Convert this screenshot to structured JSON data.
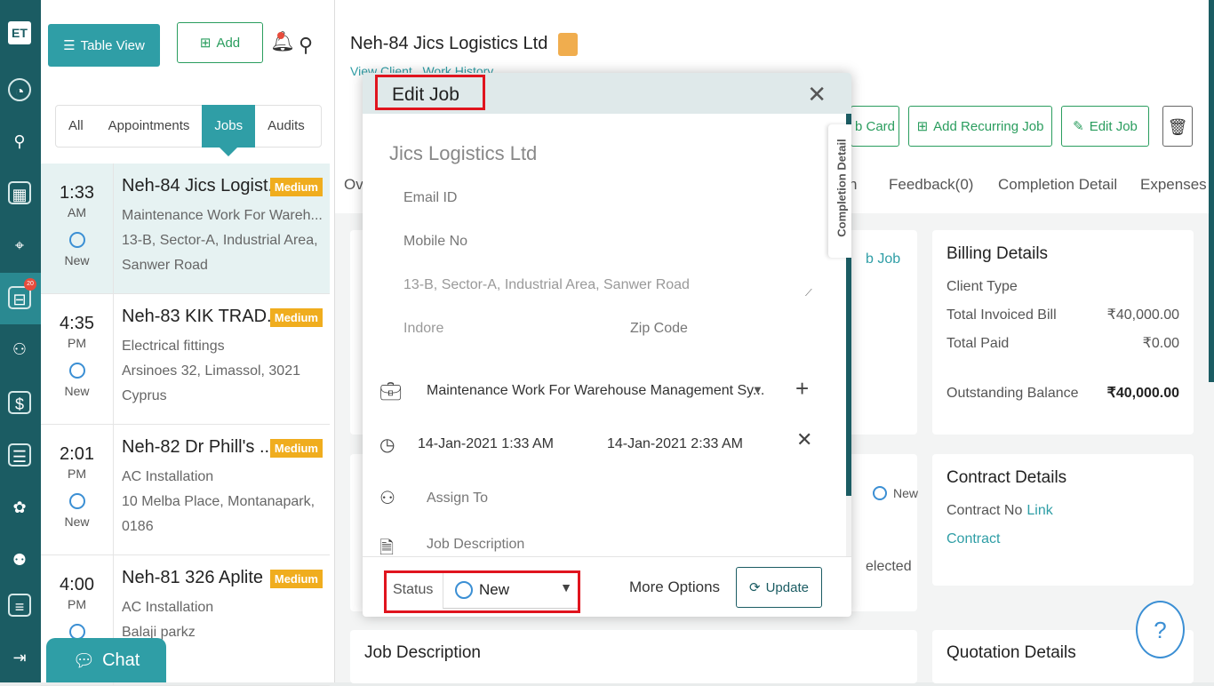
{
  "rail": {
    "logo": "ET",
    "badge": "20"
  },
  "toolbar": {
    "table_view": "Table View",
    "add": "Add"
  },
  "tabs": [
    {
      "label": "All"
    },
    {
      "label": "Appointments"
    },
    {
      "label": "Jobs"
    },
    {
      "label": "Audits"
    }
  ],
  "jobs": [
    {
      "time": "1:33",
      "ampm": "AM",
      "status": "New",
      "title": "Neh-84 Jics Logist...",
      "priority": "Medium",
      "line1": "Maintenance Work For Wareh...",
      "line2": "13-B, Sector-A, Industrial Area,",
      "line3": "Sanwer Road"
    },
    {
      "time": "4:35",
      "ampm": "PM",
      "status": "New",
      "title": "Neh-83 KIK TRAD...",
      "priority": "Medium",
      "line1": "Electrical fittings",
      "line2": "Arsinoes 32, Limassol, 3021",
      "line3": "Cyprus"
    },
    {
      "time": "2:01",
      "ampm": "PM",
      "status": "New",
      "title": "Neh-82 Dr Phill's ...",
      "priority": "Medium",
      "line1": "AC Installation",
      "line2": "10 Melba Place, Montanapark,",
      "line3": "0186"
    },
    {
      "time": "4:00",
      "ampm": "PM",
      "status": "",
      "title": "Neh-81 326 Aplite",
      "priority": "Medium",
      "line1": "AC Installation",
      "line2": "Balaji parkz",
      "line3": ""
    }
  ],
  "header": {
    "title": "Neh-84 Jics Logistics Ltd",
    "view_client": "View Client",
    "work_history": "Work History",
    "job_card_partial": "b Card",
    "add_recurring": "Add Recurring Job",
    "edit_job": "Edit Job"
  },
  "subtabs": {
    "ov": "Ov",
    "n": "n",
    "feedback": "Feedback(0)",
    "completion": "Completion Detail",
    "expenses": "Expenses"
  },
  "billing": {
    "title": "Billing Details",
    "client_type": "Client Type",
    "invoiced_label": "Total Invoiced Bill",
    "invoiced": "₹40,000.00",
    "paid_label": "Total Paid",
    "paid": "₹0.00",
    "outstanding_label": "Outstanding Balance",
    "outstanding": "₹40,000.00"
  },
  "contract": {
    "title": "Contract Details",
    "no_label": "Contract No",
    "link": "Link",
    "contract": "Contract"
  },
  "quotation": {
    "title": "Quotation Details"
  },
  "job_description_title": "Job Description",
  "behind": {
    "b_job": "b Job",
    "new": "New",
    "elected": "elected"
  },
  "modal": {
    "title": "Edit Job",
    "client": "Jics Logistics Ltd",
    "email_placeholder": "Email ID",
    "mobile_placeholder": "Mobile No",
    "address": "13-B, Sector-A, Industrial Area, Sanwer Road",
    "city": "Indore",
    "zip_placeholder": "Zip Code",
    "job_type": "Maintenance Work For Warehouse Management Sy...",
    "start": "14-Jan-2021 1:33 AM",
    "end": "14-Jan-2021 2:33 AM",
    "assign": "Assign To",
    "job_desc": "Job Description",
    "side_tab": "Completion Detail",
    "status_label": "Status",
    "status_value": "New",
    "more_options": "More Options",
    "update": "Update"
  },
  "chat": "Chat",
  "help": "?"
}
